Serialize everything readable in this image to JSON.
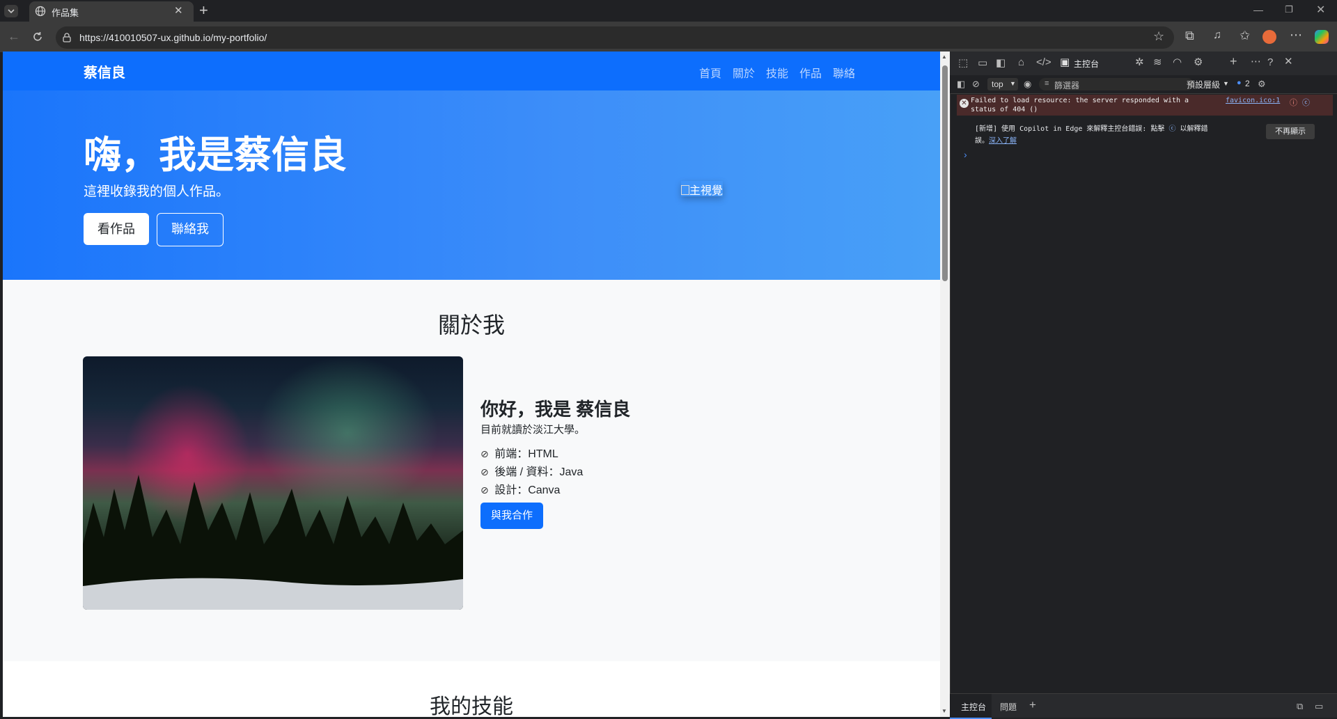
{
  "browser": {
    "tab_title": "作品集",
    "url": "https://410010507-ux.github.io/my-portfolio/"
  },
  "page": {
    "brand": "蔡信良",
    "nav": [
      "首頁",
      "關於",
      "技能",
      "作品",
      "聯絡"
    ],
    "hero": {
      "title": "嗨，我是蔡信良",
      "subtitle": "這裡收錄我的個人作品。",
      "btn_works": "看作品",
      "btn_contact": "聯絡我",
      "image_alt": "主視覺"
    },
    "about": {
      "heading": "關於我",
      "name_line": "你好，我是 蔡信良",
      "desc": "目前就讀於淡江大學。",
      "skills": [
        "前端：HTML",
        "後端 / 資料：Java",
        "設計：Canva"
      ],
      "cta": "與我合作"
    },
    "skills_section": {
      "heading": "我的技能"
    }
  },
  "devtools": {
    "console_tab": "主控台",
    "context": "top",
    "filter_placeholder": "篩選器",
    "levels": "預設層級",
    "issues_count": "2",
    "error_msg_line1": "Failed to load resource: the server responded with a",
    "error_msg_line2": "status of 404 ()",
    "error_link": "favicon.ico:1",
    "info_line1": "[新增] 使用 Copilot in Edge 來解釋主控台錯誤: 點擊",
    "info_line1b": "以解釋錯",
    "info_line2": "誤。",
    "info_link": "深入了解",
    "dismiss_btn": "不再顯示",
    "bottom_tabs": [
      "主控台",
      "問題"
    ]
  },
  "colors": {
    "primary": "#0d6efd",
    "devtools_bg": "#202124",
    "error_bg": "#4a2a2a"
  }
}
